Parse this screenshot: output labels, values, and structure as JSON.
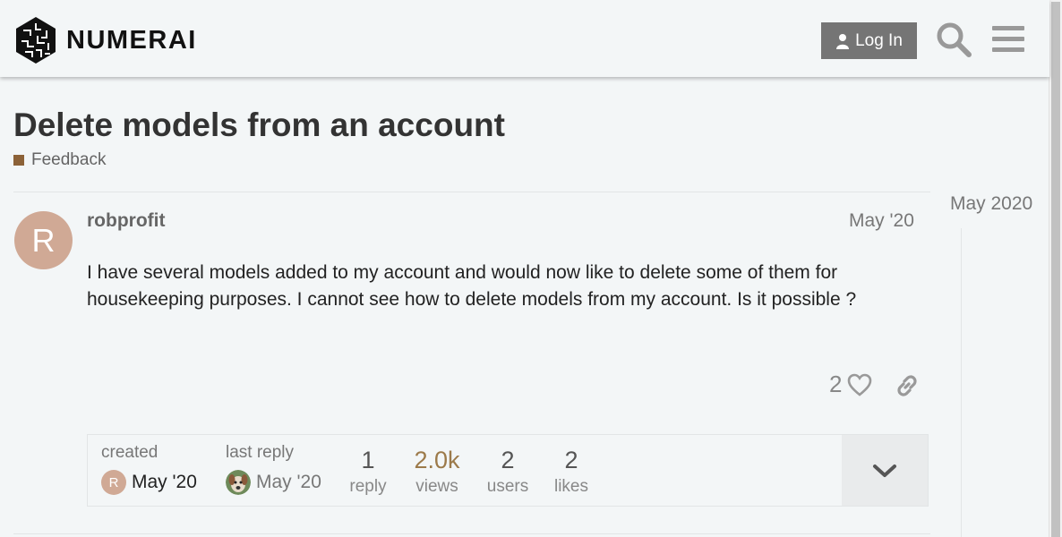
{
  "header": {
    "logo_text": "NUMERAI",
    "login_label": "Log In",
    "icons": {
      "user": "user-icon",
      "search": "search-icon",
      "menu": "hamburger-icon"
    }
  },
  "topic": {
    "title": "Delete models from an account",
    "category": {
      "label": "Feedback",
      "color": "#8c6238"
    }
  },
  "post": {
    "author": "robprofit",
    "avatar_letter": "R",
    "avatar_color": "#d0a995",
    "date": "May '20",
    "body": "I have several models added to my account and would now like to delete some of them for housekeeping purposes. I cannot see how to delete models from my account. Is it possible ?",
    "like_count": "2"
  },
  "summary": {
    "created_label": "created",
    "created_date": "May '20",
    "last_reply_label": "last reply",
    "last_reply_date": "May '20",
    "stats": [
      {
        "value": "1",
        "label": "reply"
      },
      {
        "value": "2.0k",
        "label": "views"
      },
      {
        "value": "2",
        "label": "users"
      },
      {
        "value": "2",
        "label": "likes"
      }
    ]
  },
  "timeline": {
    "date": "May 2020"
  }
}
